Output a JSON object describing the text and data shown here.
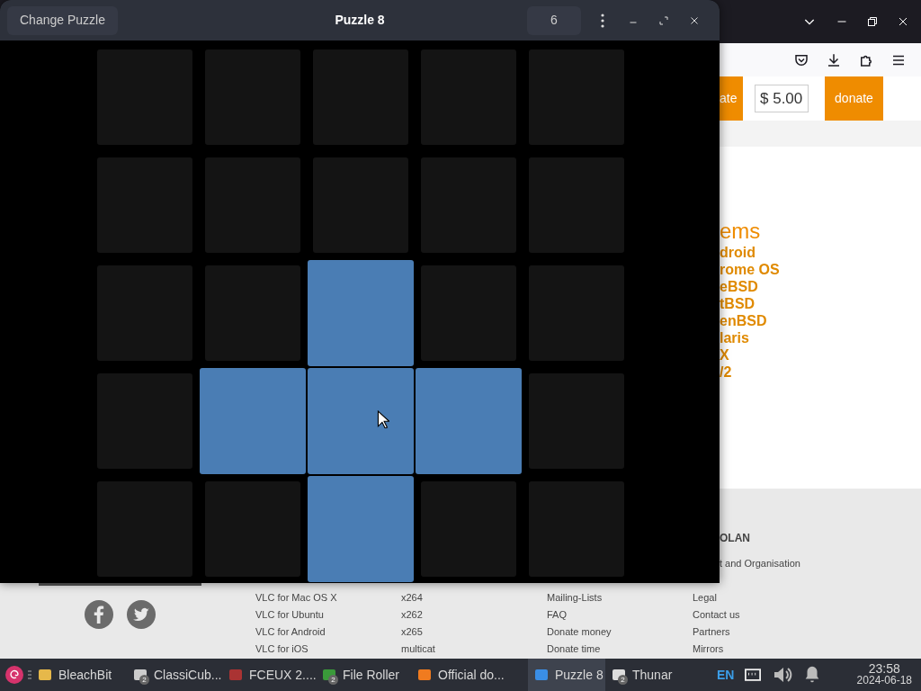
{
  "puzzle_window": {
    "change_button": "Change Puzzle",
    "title": "Puzzle 8",
    "moves": "6",
    "grid": [
      [
        {
          "on": false
        },
        {
          "on": false
        },
        {
          "on": false
        },
        {
          "on": false
        },
        {
          "on": false
        }
      ],
      [
        {
          "on": false
        },
        {
          "on": false
        },
        {
          "on": false
        },
        {
          "on": false
        },
        {
          "on": false
        }
      ],
      [
        {
          "on": false
        },
        {
          "on": false
        },
        {
          "on": true
        },
        {
          "on": false
        },
        {
          "on": false
        }
      ],
      [
        {
          "on": false
        },
        {
          "on": true
        },
        {
          "on": true
        },
        {
          "on": true
        },
        {
          "on": false
        }
      ],
      [
        {
          "on": false
        },
        {
          "on": false
        },
        {
          "on": true
        },
        {
          "on": false
        },
        {
          "on": false
        }
      ]
    ]
  },
  "browser": {
    "donate_partial": "ate",
    "amount": "$ 5.00",
    "donate_button": "donate",
    "heading": "ems",
    "os_links": [
      "droid",
      "rome OS",
      "eBSD",
      "tBSD",
      "enBSD",
      "laris",
      "X",
      "/2"
    ],
    "footer_heading": "OLAN",
    "footer_link": "t and Organisation",
    "footer_columns": [
      [
        "VLC for Mac OS X",
        "VLC for Ubuntu",
        "VLC for Android",
        "VLC for iOS"
      ],
      [
        "x264",
        "x262",
        "x265",
        "multicat"
      ],
      [
        "Mailing-Lists",
        "FAQ",
        "Donate money",
        "Donate time"
      ],
      [
        "Legal",
        "Contact us",
        "Partners",
        "Mirrors"
      ]
    ]
  },
  "taskbar": {
    "items": [
      {
        "label": "BleachBit",
        "selected": false
      },
      {
        "label": "ClassiCub...",
        "badge": "2",
        "selected": false
      },
      {
        "label": "FCEUX 2....",
        "selected": false
      },
      {
        "label": "File Roller",
        "badge": "2",
        "selected": false
      },
      {
        "label": "Official do...",
        "selected": false
      },
      {
        "label": "Puzzle 8",
        "selected": true
      },
      {
        "label": "Thunar",
        "badge": "2",
        "selected": false
      }
    ],
    "language": "EN",
    "time": "23:58",
    "date": "2024-06-18"
  }
}
